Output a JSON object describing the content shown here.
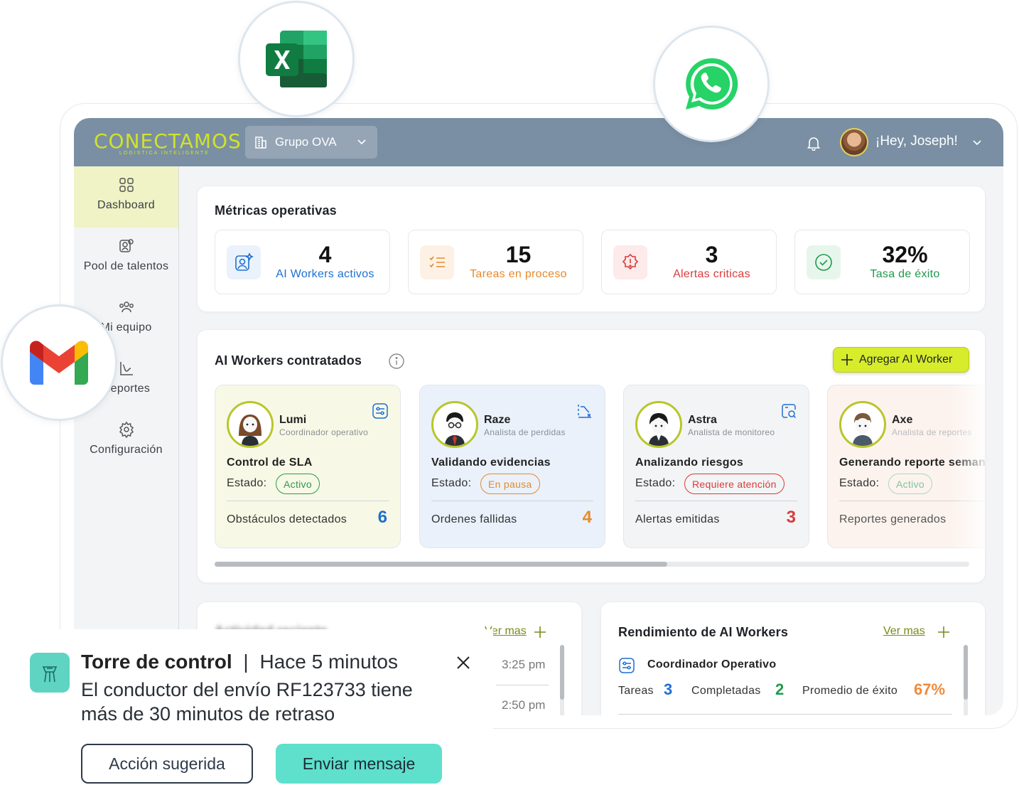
{
  "header": {
    "logo_text": "CONECTAMOS",
    "logo_subtitle": "LOGISTICA INTELIGENTE",
    "org_name": "Grupo OVA",
    "greeting": "¡Hey, Joseph!"
  },
  "sidebar": {
    "items": [
      {
        "label": "Dashboard",
        "icon": "grid-icon",
        "active": true
      },
      {
        "label": "Pool de talentos",
        "icon": "user-search-icon"
      },
      {
        "label": "Mi equipo",
        "icon": "team-icon"
      },
      {
        "label": "Reportes",
        "icon": "chart-icon"
      },
      {
        "label": "Configuración",
        "icon": "gear-icon"
      }
    ]
  },
  "metrics": {
    "title": "Métricas operativas",
    "cards": [
      {
        "value": "4",
        "label": "AI Workers activos",
        "color": "#1f6fd1",
        "bg": "#eaf2fc"
      },
      {
        "value": "15",
        "label": "Tareas en proceso",
        "color": "#e58a2e",
        "bg": "#fdf1e6"
      },
      {
        "value": "3",
        "label": "Alertas criticas",
        "color": "#d93b3b",
        "bg": "#fdeaea"
      },
      {
        "value": "32%",
        "label": "Tasa de éxito",
        "color": "#1e9a4c",
        "bg": "#e7f6ec"
      }
    ]
  },
  "workers": {
    "title": "AI Workers contratados",
    "add_button": "Agregar AI Worker",
    "state_label": "Estado:",
    "cards": [
      {
        "name": "Lumi",
        "role": "Coordinador operativo",
        "task": "Control de SLA",
        "status": "Activo",
        "status_color": "#2e9a4a",
        "footer": "Obstáculos detectados",
        "count": "6",
        "count_color": "#1f6fd1",
        "bg": "#f7f9e6"
      },
      {
        "name": "Raze",
        "role": "Analista de perdidas",
        "task": "Validando evidencias",
        "status": "En pausa",
        "status_color": "#e58a2e",
        "footer": "Ordenes fallidas",
        "count": "4",
        "count_color": "#e58a2e",
        "bg": "#eaf1fb"
      },
      {
        "name": "Astra",
        "role": "Analista de monitoreo",
        "task": "Analizando riesgos",
        "status": "Requiere atención",
        "status_color": "#d93b3b",
        "footer": "Alertas emitidas",
        "count": "3",
        "count_color": "#d93b3b",
        "bg": "#f3f4f5"
      },
      {
        "name": "Axe",
        "role": "Analista de reportes",
        "task": "Generando reporte semanal",
        "status": "Activo",
        "status_color": "#2e9a4a",
        "footer": "Reportes generados",
        "count": "",
        "count_color": "#1e9a4c",
        "bg": "#fcf3ee"
      }
    ],
    "scroll_fraction": 0.6
  },
  "activity": {
    "title": "Actividad reciente",
    "more": "Ver mas",
    "times": [
      "3:25 pm",
      "2:50 pm"
    ]
  },
  "performance": {
    "title": "Rendimiento de AI Workers",
    "more": "Ver mas",
    "row_title": "Coordinador Operativo",
    "tasks_label": "Tareas",
    "tasks_value": "3",
    "done_label": "Completadas",
    "done_value": "2",
    "avg_label": "Promedio de éxito",
    "avg_value": "67%"
  },
  "notification": {
    "source": "Torre de control",
    "separator": "|",
    "time": "Hace 5 minutos",
    "message": "El conductor del envío RF123733 tiene más de 30 minutos de retraso",
    "action_secondary": "Acción sugerida",
    "action_primary": "Enviar mensaje"
  },
  "integrations": [
    "excel-icon",
    "whatsapp-icon",
    "gmail-icon"
  ]
}
